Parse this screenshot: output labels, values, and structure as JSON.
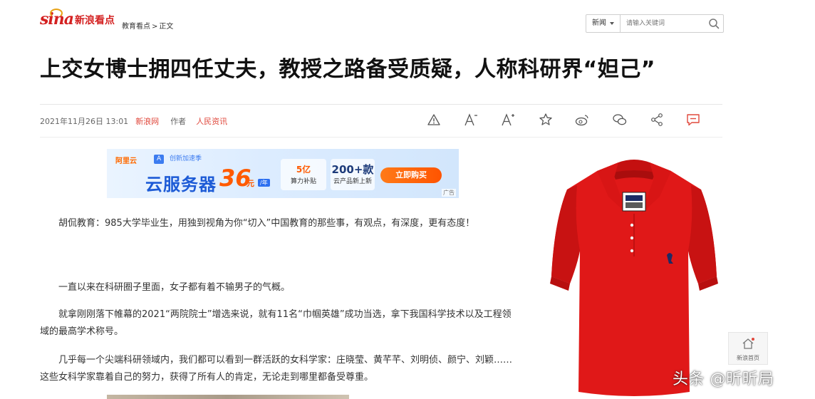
{
  "header": {
    "logo_sina": "sina",
    "logo_text": "新浪看点",
    "breadcrumb": [
      "教育看点",
      "正文"
    ],
    "breadcrumb_sep": ">",
    "search": {
      "scope": "新闻",
      "placeholder": "请输入关键词"
    }
  },
  "article": {
    "title": "上交女博士拥四任丈夫，教授之路备受质疑，人称科研界“妲己”",
    "date": "2021年11月26日 13:01",
    "source": "新浪网",
    "author_label": "作者",
    "author": "人民资讯",
    "paragraphs": [
      "胡侃教育：985大学毕业生，用独到视角为你“切入”中国教育的那些事，有观点，有深度，更有态度！",
      "一直以来在科研圈子里面，女子都有着不输男子的气概。",
      "就拿刚刚落下帷幕的2021“两院院士”增选来说，就有11名“巾帼英雄”成功当选，拿下我国科学技术以及工程领域的最高学术称号。",
      "几乎每一个尖端科研领域内，我们都可以看到一群活跃的女科学家：庄晓莹、黄芊芊、刘明侦、颜宁、刘颖……这些女科学家靠着自己的努力，获得了所有人的肯定，无论走到哪里都备受尊重。"
    ]
  },
  "tools": [
    {
      "name": "report-icon"
    },
    {
      "name": "font-decrease-icon",
      "label": "A-"
    },
    {
      "name": "font-increase-icon",
      "label": "A+"
    },
    {
      "name": "favorite-star-icon"
    },
    {
      "name": "weibo-share-icon"
    },
    {
      "name": "wechat-share-icon"
    },
    {
      "name": "share-icon"
    },
    {
      "name": "comment-icon"
    }
  ],
  "ad": {
    "brand": "阿里云",
    "tag": "A",
    "tag_text": "创新加速季",
    "headline": "云服务器",
    "price": "36",
    "unit": "元",
    "badge": "/年",
    "card1_big": "5亿",
    "card1_small": "算力补贴",
    "card2_big": "200+款",
    "card2_small": "云产品新上新",
    "cta": "立即购买",
    "marker": "广告"
  },
  "side_widget": {
    "label": "新浪首页"
  },
  "watermark": "头条 @昕昕局",
  "colors": {
    "brand_red": "#d42121",
    "accent_orange": "#e0483c",
    "ad_blue": "#1d5bd6",
    "shirt_red": "#e01818"
  }
}
